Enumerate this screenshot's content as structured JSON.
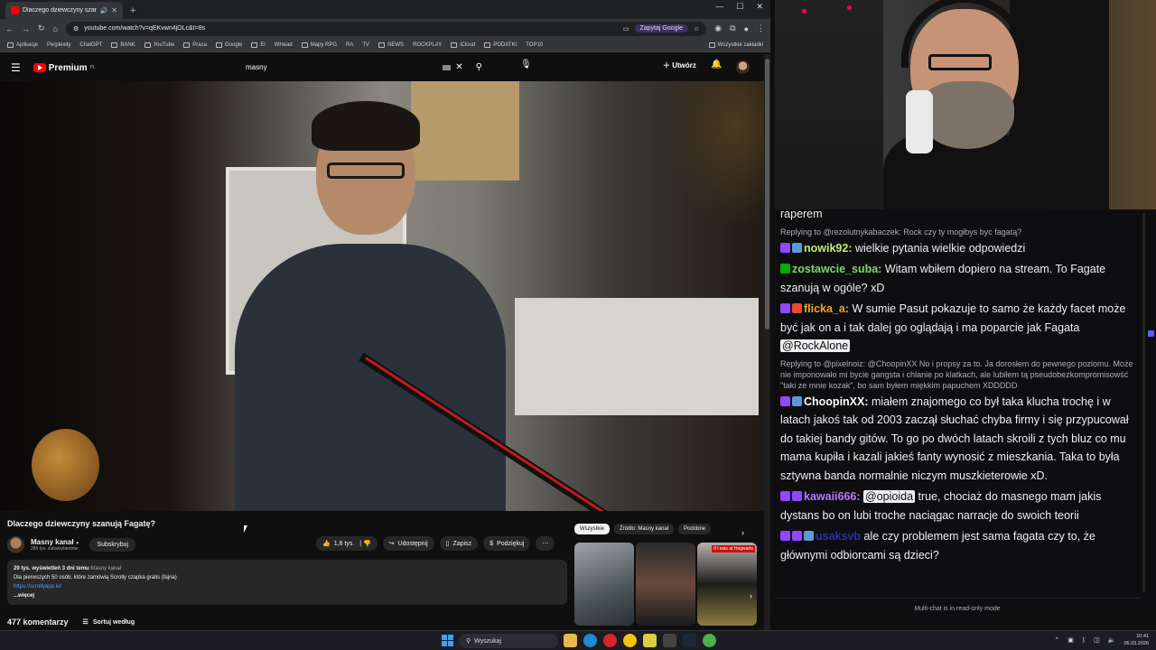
{
  "browser": {
    "tab_title": "Dlaczego dziewczyny szan...",
    "url": "youtube.com/watch?v=qEKvwn4jOLc&t=8s",
    "ask_google": "Zapytaj Google",
    "bookmarks": [
      "Aplikacje",
      "Perplexity",
      "ChatGPT",
      "BANK",
      "YouTube",
      "Praca",
      "Google",
      "El",
      "WHead",
      "Mapy RPG",
      "RA",
      "TV",
      "NEWS",
      "ROCKPLAY",
      "iCloud",
      "PODATKI",
      "TOP10"
    ],
    "bookmarks_all": "Wszystkie zakładki"
  },
  "youtube": {
    "logo": "Premium",
    "logo_sup": "PL",
    "search_query": "masny",
    "create_label": "Utwórz",
    "video_title": "Dlaczego dziewczyny szanują Fagatę?",
    "channel_name": "Masny kanał",
    "channel_subs": "285 tys. subskrybentów",
    "subscribed_label": "Subskrybuj",
    "like_count": "1,8 tys.",
    "share_label": "Udostępnij",
    "save_label": "Zapisz",
    "thanks_label": "Podziękuj",
    "desc_views": "29 tys. wyświetleń  3 dni temu",
    "desc_channel": "Masny kanał",
    "desc_line": "Dla pierwszych 50 osób, które zamówią Scrolly czapka gratis (fajna)",
    "desc_link": "https://scrollyapp.io/",
    "desc_more": "...więcej",
    "comments_count": "477 komentarzy",
    "sort_label": "Sortuj według",
    "chips": [
      "Wszystkie",
      "Źródło: Masny kanał",
      "Podobne"
    ],
    "thumb_tag": "If I was at Hogwarts"
  },
  "chat": {
    "top_partial": "raperem",
    "messages": [
      {
        "reply": "Replying to @rezolutnykabaczek: Rock czy ty mogłbys byc fagatą?",
        "user": "nowik92:",
        "text": " wielkie pytania wielkie odpowiedzi",
        "color": "#b8f06e"
      },
      {
        "reply": "",
        "user": "zostawcie_suba:",
        "text": " Witam wbiłem dopiero na stream. To Fagate szanują w ogóle? xD",
        "color": "#7bd86a"
      },
      {
        "reply": "",
        "user": "flicka_a:",
        "text": " W sumie Pasut pokazuje to samo że każdy facet może być jak on a i tak dalej go oglądają i ma poparcie jak Fagata ",
        "mention": "@RockAlone",
        "color": "#e8a33d"
      },
      {
        "reply": "Replying to @pixelnoiz: @ChoopinXX No i propsy za to. Ja dorosłem do pewnego poziomu. Może nie imponowało mi bycie gangsta i chlanie po klatkach, ale lubiłem tą pseudobezkompromisowść \"taki ze mnie kozak\", bo sam byłem miękkim papuchem XDDDDD",
        "user": "ChoopinXX:",
        "text": " miałem znajomego co był taka klucha trochę i w latach jakoś tak od 2003 zaczął słuchać chyba firmy i się przypucował do takiej bandy gitów. To go po dwóch latach skroili z tych bluz co mu mama kupiła i kazali jakieś fanty wynosić z mieszkania. Taka to była sztywna banda normalnie niczym muszkieterowie xD.",
        "color": "#ffffff"
      },
      {
        "reply": "",
        "user": "kawaii666:",
        "text": " true, chociaż do masnego mam jakis dystans bo on lubi troche naciągac narracje do swoich teorii",
        "mention_before": "@opioida",
        "color": "#b57bff"
      },
      {
        "reply": "",
        "user": "usaksvb",
        "text": " ale czy problemem jest sama fagata czy to, że głównymi odbiorcami są dzieci?",
        "color": "#2e2ea8"
      }
    ],
    "footer": "Multi-chat is in read-only mode"
  },
  "taskbar": {
    "search_placeholder": "Wyszukaj",
    "time": "10:41",
    "date": "06.03.2026"
  }
}
